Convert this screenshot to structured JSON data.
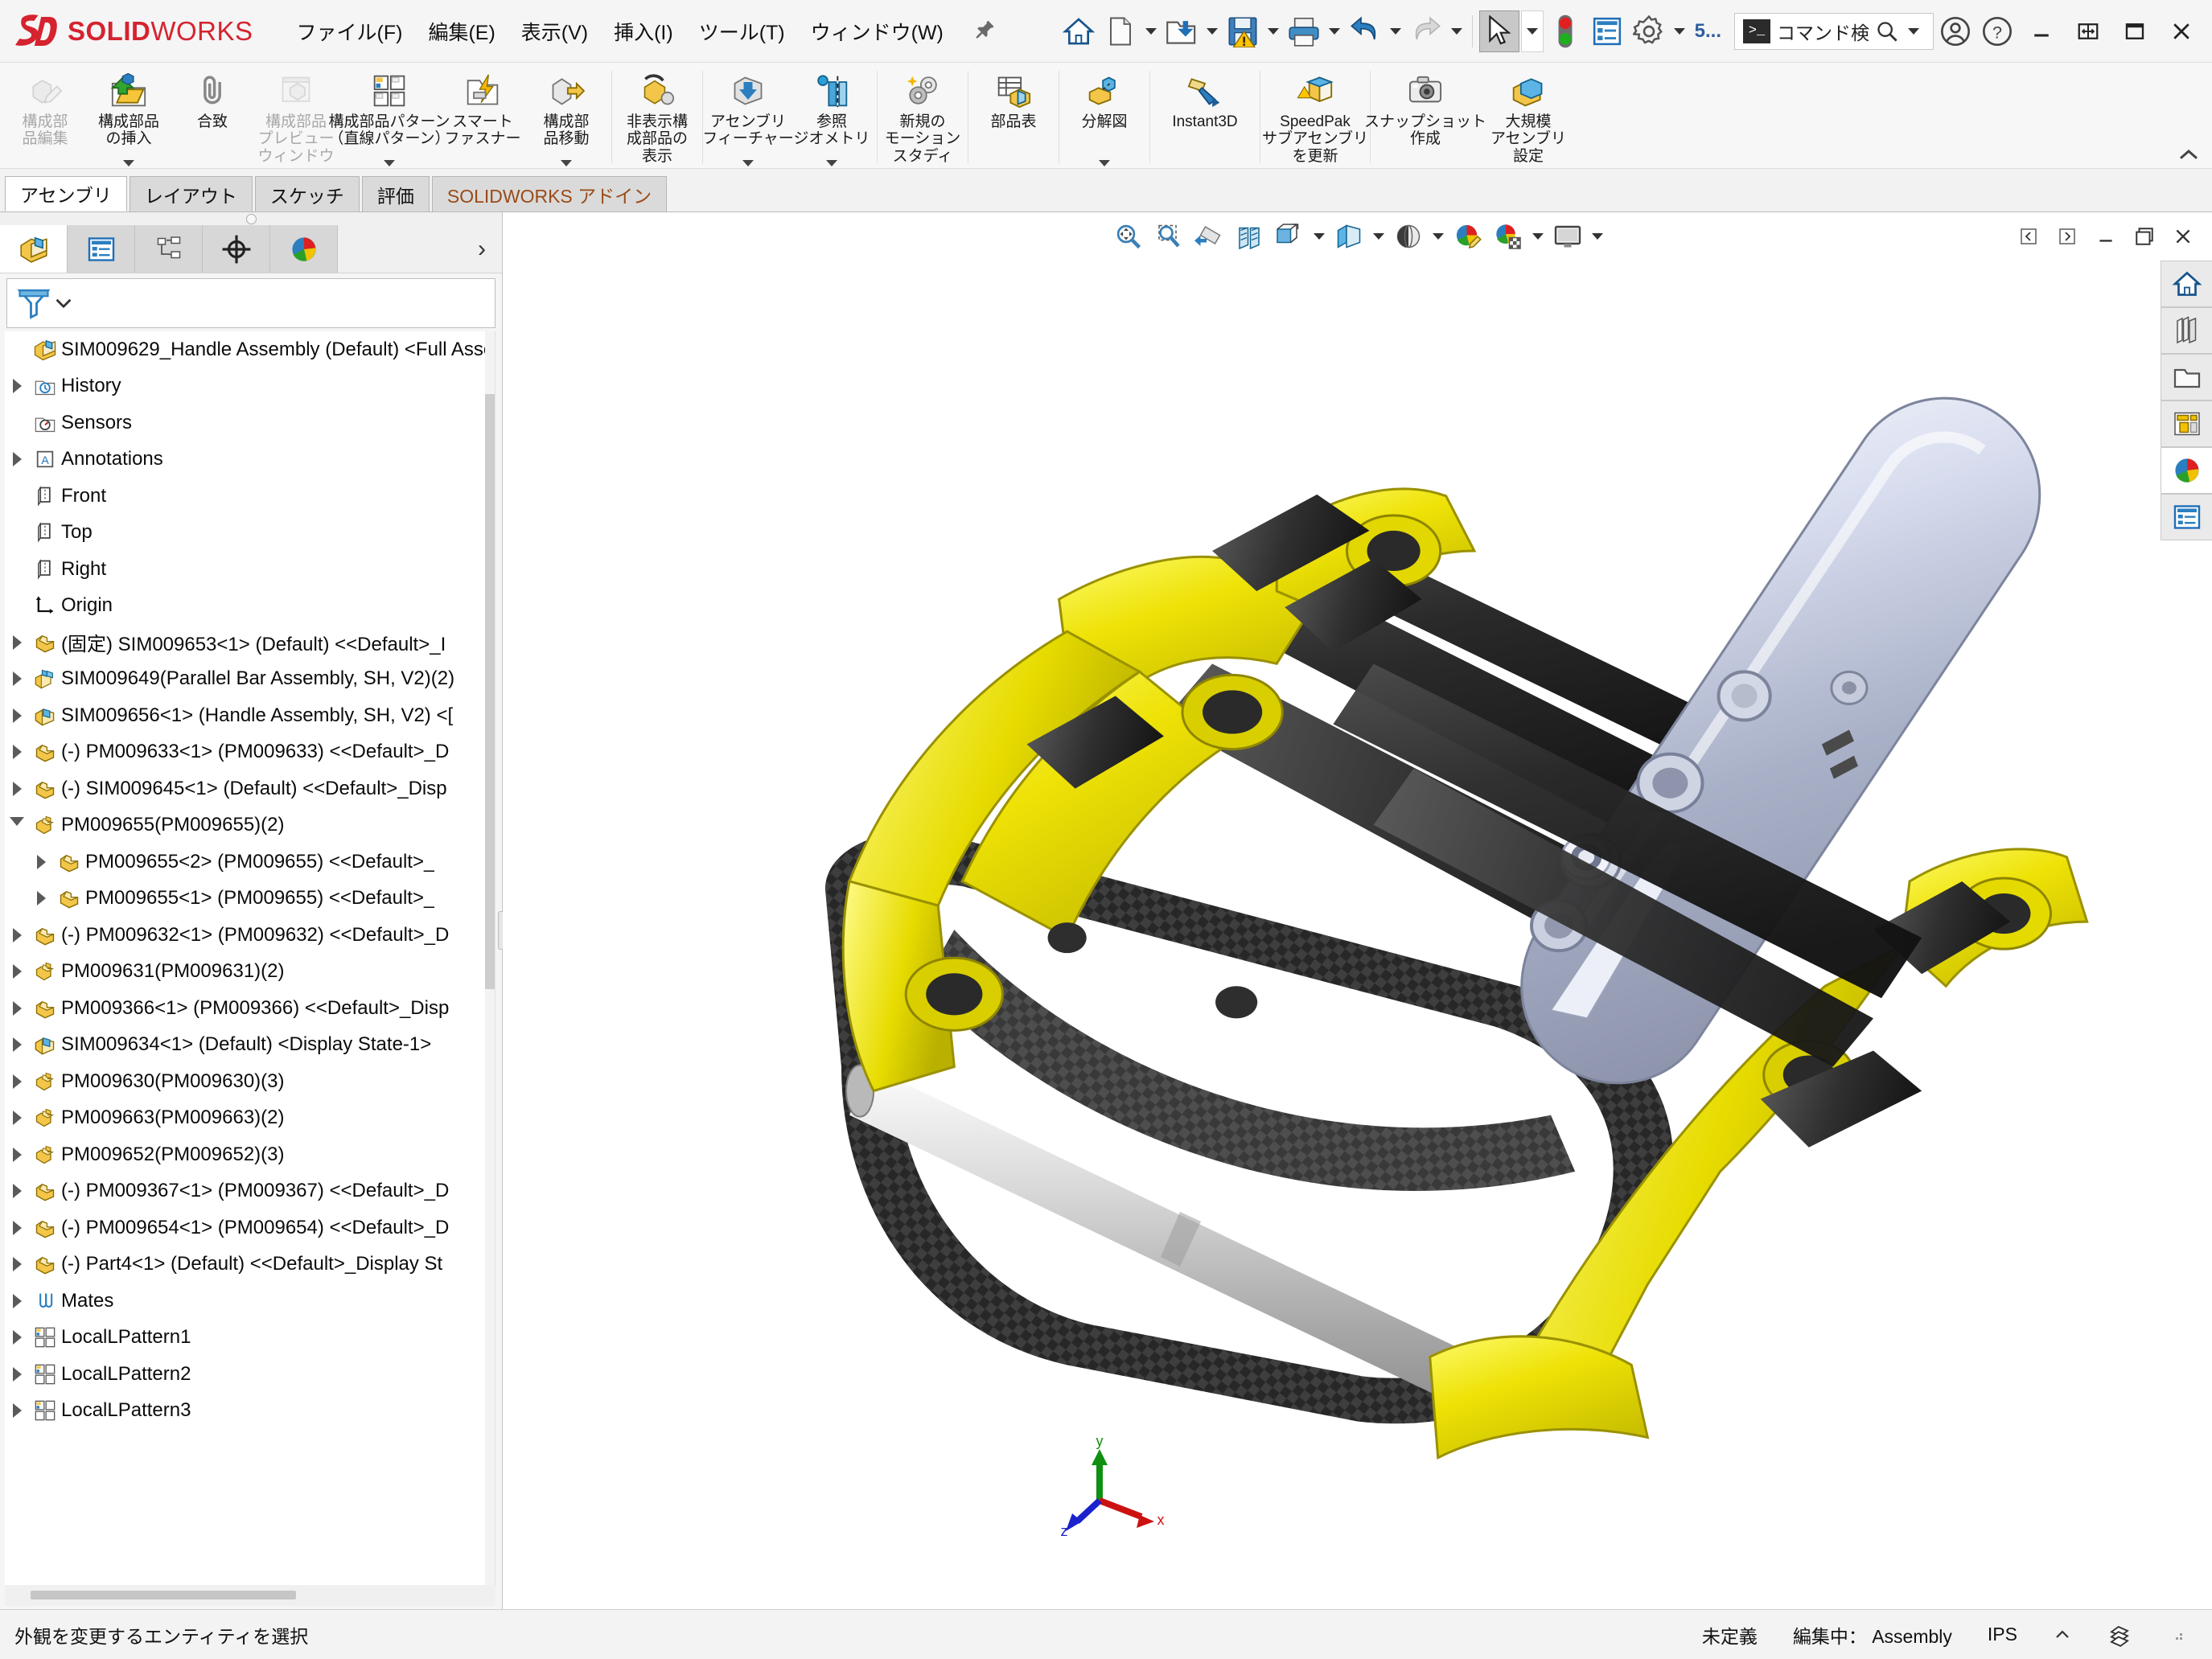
{
  "app": {
    "brand_bold": "SOLID",
    "brand_light": "WORKS",
    "logo": "3DS"
  },
  "menu": {
    "items": [
      {
        "label": "ファイル(F)",
        "name": "menu-file"
      },
      {
        "label": "編集(E)",
        "name": "menu-edit"
      },
      {
        "label": "表示(V)",
        "name": "menu-view"
      },
      {
        "label": "挿入(I)",
        "name": "menu-insert"
      },
      {
        "label": "ツール(T)",
        "name": "menu-tools"
      },
      {
        "label": "ウィンドウ(W)",
        "name": "menu-window"
      }
    ],
    "pin": "pin-icon"
  },
  "quickaccess": {
    "items": [
      {
        "name": "home-icon",
        "caret": false
      },
      {
        "name": "new-document-icon",
        "caret": true
      },
      {
        "name": "open-document-icon",
        "caret": true
      },
      {
        "name": "save-warning-icon",
        "caret": true
      },
      {
        "name": "print-icon",
        "caret": true
      },
      {
        "name": "undo-icon",
        "caret": true
      },
      {
        "name": "redo-icon",
        "caret": true
      },
      {
        "name": "select-cursor-icon",
        "caret": true
      },
      {
        "name": "rebuild-traffic-light-icon",
        "caret": false
      },
      {
        "name": "display-list-icon",
        "caret": false
      },
      {
        "name": "options-gear-icon",
        "caret": true
      }
    ],
    "sw_label": "5...",
    "search": {
      "placeholder": "コマンド検",
      "value": "コマンド検",
      "cmd_icon": "command-prompt-icon",
      "magnifier": "search-icon",
      "caret": "chevron-down-icon"
    },
    "account_icon": "user-account-icon",
    "help_icon": "help-question-icon"
  },
  "windowcontrols": {
    "minimize": "minimize-icon",
    "restore_panes": "split-panes-icon",
    "maximize": "maximize-icon",
    "close": "close-icon"
  },
  "ribbon": {
    "buttons": [
      {
        "label": "構成部\n品編集",
        "name": "edit-component",
        "icon": "edit-component-icon",
        "disabled": true,
        "caret": false
      },
      {
        "label": "構成部品\nの挿入",
        "name": "insert-components",
        "icon": "insert-components-icon",
        "disabled": false,
        "caret": true
      },
      {
        "label": "合致",
        "name": "mate",
        "icon": "mate-paperclip-icon",
        "disabled": false,
        "caret": false
      },
      {
        "label": "構成部品\nプレビュー\nウィンドウ",
        "name": "component-preview-window",
        "icon": "component-preview-icon",
        "disabled": true,
        "caret": false
      },
      {
        "label": "構成部品パターン\n（直線パターン）",
        "name": "linear-component-pattern",
        "icon": "linear-pattern-icon",
        "disabled": false,
        "caret": true
      },
      {
        "label": "スマート\nファスナー",
        "name": "smart-fasteners",
        "icon": "smart-fastener-icon",
        "disabled": false,
        "caret": false
      },
      {
        "label": "構成部\n品移動",
        "name": "move-component",
        "icon": "move-component-icon",
        "disabled": false,
        "caret": true
      },
      {
        "label": "非表示構\n成部品の\n表示",
        "name": "show-hidden-components",
        "icon": "show-hidden-icon",
        "disabled": false,
        "caret": false
      },
      {
        "label": "アセンブリ\nフィーチャー",
        "name": "assembly-features",
        "icon": "assembly-features-icon",
        "disabled": false,
        "caret": true
      },
      {
        "label": "参照\nジオメトリ",
        "name": "reference-geometry",
        "icon": "reference-geometry-icon",
        "disabled": false,
        "caret": true
      },
      {
        "label": "新規の\nモーション\nスタディ",
        "name": "new-motion-study",
        "icon": "motion-study-icon",
        "disabled": false,
        "caret": false
      },
      {
        "label": "部品表",
        "name": "bill-of-materials",
        "icon": "bom-icon",
        "disabled": false,
        "caret": false
      },
      {
        "label": "分解図",
        "name": "exploded-view",
        "icon": "exploded-view-icon",
        "disabled": false,
        "caret": true
      },
      {
        "label": "Instant3D",
        "name": "instant3d",
        "icon": "instant3d-icon",
        "disabled": false,
        "caret": false
      },
      {
        "label": "SpeedPak\nサブアセンブリ\nを更新",
        "name": "update-speedpak-subassembly",
        "icon": "speedpak-icon",
        "disabled": false,
        "caret": false
      },
      {
        "label": "スナップショット\n作成",
        "name": "take-snapshot",
        "icon": "camera-icon",
        "disabled": false,
        "caret": false
      },
      {
        "label": "大規模\nアセンブリ\n設定",
        "name": "large-assembly-settings",
        "icon": "large-assembly-icon",
        "disabled": false,
        "caret": false
      }
    ],
    "collapse_icon": "chevron-up-icon"
  },
  "tabs": [
    {
      "label": "アセンブリ",
      "name": "tab-assembly",
      "active": true
    },
    {
      "label": "レイアウト",
      "name": "tab-layout",
      "active": false
    },
    {
      "label": "スケッチ",
      "name": "tab-sketch",
      "active": false
    },
    {
      "label": "評価",
      "name": "tab-evaluate",
      "active": false
    },
    {
      "label": "SOLIDWORKS アドイン",
      "name": "tab-solidworks-addins",
      "active": false
    }
  ],
  "panel": {
    "tabs": [
      {
        "name": "feature-manager-tab",
        "icon": "feature-tree-icon",
        "active": true
      },
      {
        "name": "property-manager-tab",
        "icon": "property-manager-icon",
        "active": false
      },
      {
        "name": "configuration-manager-tab",
        "icon": "configuration-manager-icon",
        "active": false
      },
      {
        "name": "dimxpert-manager-tab",
        "icon": "dimxpert-icon",
        "active": false
      },
      {
        "name": "display-manager-tab",
        "icon": "display-manager-icon",
        "active": false
      }
    ],
    "more_icon": "chevron-right-icon",
    "filter": {
      "icon": "filter-funnel-icon",
      "caret": "chevron-down-icon",
      "placeholder": "",
      "value": ""
    }
  },
  "tree": {
    "root": {
      "label": "SIM009629_Handle Assembly (Default) <Full Asse",
      "icon": "assembly-icon"
    },
    "items": [
      {
        "label": "History",
        "icon": "history-icon",
        "indent": 1,
        "arrow": "closed"
      },
      {
        "label": "Sensors",
        "icon": "sensors-icon",
        "indent": 1,
        "arrow": "none"
      },
      {
        "label": "Annotations",
        "icon": "annotations-icon",
        "indent": 1,
        "arrow": "closed"
      },
      {
        "label": "Front",
        "icon": "plane-icon",
        "indent": 1,
        "arrow": "none"
      },
      {
        "label": "Top",
        "icon": "plane-icon",
        "indent": 1,
        "arrow": "none"
      },
      {
        "label": "Right",
        "icon": "plane-icon",
        "indent": 1,
        "arrow": "none"
      },
      {
        "label": "Origin",
        "icon": "origin-icon",
        "indent": 1,
        "arrow": "none"
      },
      {
        "label": "(固定) SIM009653<1> (Default) <<Default>_I",
        "icon": "part-icon",
        "indent": 1,
        "arrow": "closed"
      },
      {
        "label": "SIM009649(Parallel Bar Assembly, SH, V2)(2)",
        "icon": "subassembly-pattern-icon",
        "indent": 1,
        "arrow": "closed"
      },
      {
        "label": "SIM009656<1> (Handle Assembly, SH, V2) <[",
        "icon": "subassembly-icon",
        "indent": 1,
        "arrow": "closed"
      },
      {
        "label": "(-) PM009633<1> (PM009633) <<Default>_D",
        "icon": "part-icon",
        "indent": 1,
        "arrow": "closed"
      },
      {
        "label": "(-) SIM009645<1> (Default) <<Default>_Disp",
        "icon": "part-icon",
        "indent": 1,
        "arrow": "closed"
      },
      {
        "label": "PM009655(PM009655)(2)",
        "icon": "component-pattern-icon",
        "indent": 1,
        "arrow": "open"
      },
      {
        "label": "PM009655<2> (PM009655) <<Default>_",
        "icon": "part-icon",
        "indent": 2,
        "arrow": "closed"
      },
      {
        "label": "PM009655<1> (PM009655) <<Default>_",
        "icon": "part-icon",
        "indent": 2,
        "arrow": "closed"
      },
      {
        "label": "(-) PM009632<1> (PM009632) <<Default>_D",
        "icon": "part-icon",
        "indent": 1,
        "arrow": "closed"
      },
      {
        "label": "PM009631(PM009631)(2)",
        "icon": "component-pattern-icon",
        "indent": 1,
        "arrow": "closed"
      },
      {
        "label": "PM009366<1> (PM009366) <<Default>_Disp",
        "icon": "part-icon",
        "indent": 1,
        "arrow": "closed"
      },
      {
        "label": "SIM009634<1> (Default) <Display State-1>",
        "icon": "subassembly-icon",
        "indent": 1,
        "arrow": "closed"
      },
      {
        "label": "PM009630(PM009630)(3)",
        "icon": "component-pattern-icon",
        "indent": 1,
        "arrow": "closed"
      },
      {
        "label": "PM009663(PM009663)(2)",
        "icon": "component-pattern-icon",
        "indent": 1,
        "arrow": "closed"
      },
      {
        "label": "PM009652(PM009652)(3)",
        "icon": "component-pattern-icon",
        "indent": 1,
        "arrow": "closed"
      },
      {
        "label": "(-) PM009367<1> (PM009367) <<Default>_D",
        "icon": "part-icon",
        "indent": 1,
        "arrow": "closed"
      },
      {
        "label": "(-) PM009654<1> (PM009654) <<Default>_D",
        "icon": "part-icon",
        "indent": 1,
        "arrow": "closed"
      },
      {
        "label": "(-) Part4<1> (Default) <<Default>_Display St",
        "icon": "part-icon",
        "indent": 1,
        "arrow": "closed"
      },
      {
        "label": "Mates",
        "icon": "mates-icon",
        "indent": 1,
        "arrow": "closed"
      },
      {
        "label": "LocalLPattern1",
        "icon": "linear-pattern-icon",
        "indent": 1,
        "arrow": "closed"
      },
      {
        "label": "LocalLPattern2",
        "icon": "linear-pattern-icon",
        "indent": 1,
        "arrow": "closed"
      },
      {
        "label": "LocalLPattern3",
        "icon": "linear-pattern-icon",
        "indent": 1,
        "arrow": "closed"
      }
    ]
  },
  "viewtoolbar": {
    "buttons": [
      {
        "name": "zoom-to-fit-icon",
        "caret": false
      },
      {
        "name": "zoom-to-area-icon",
        "caret": false
      },
      {
        "name": "previous-view-icon",
        "caret": false
      },
      {
        "name": "section-view-icon",
        "caret": false
      },
      {
        "name": "view-orientation-icon",
        "caret": true
      },
      {
        "name": "display-style-icon",
        "caret": true
      },
      {
        "name": "hide-show-items-icon",
        "caret": true
      },
      {
        "name": "edit-appearance-icon",
        "caret": false
      },
      {
        "name": "apply-scene-icon",
        "caret": true
      },
      {
        "name": "view-settings-icon",
        "caret": true
      }
    ]
  },
  "viewportwindow": {
    "buttons": [
      {
        "name": "previous-document-icon",
        "label": "◁"
      },
      {
        "name": "next-document-icon",
        "label": "▷"
      },
      {
        "name": "minimize-window-icon",
        "label": "–"
      },
      {
        "name": "restore-window-icon",
        "label": "❐"
      },
      {
        "name": "close-window-icon",
        "label": "✕"
      }
    ]
  },
  "triad": {
    "x": "x",
    "y": "y",
    "z": "z"
  },
  "taskpane": {
    "items": [
      {
        "name": "task-pane-resources-icon",
        "active": false
      },
      {
        "name": "task-pane-design-library-icon",
        "active": false
      },
      {
        "name": "task-pane-file-explorer-icon",
        "active": false
      },
      {
        "name": "task-pane-view-palette-icon",
        "active": false
      },
      {
        "name": "task-pane-appearances-scenes-icon",
        "active": true
      },
      {
        "name": "task-pane-custom-properties-icon",
        "active": false
      }
    ]
  },
  "statusbar": {
    "message": "外観を変更するエンティティを選択",
    "state": "未定義",
    "editing": "編集中： Assembly",
    "units": "IPS",
    "units_caret": "chevron-up-icon",
    "overlay_icon": "overlay-icon"
  },
  "colors": {
    "brand_red": "#d5232f",
    "accent_blue": "#2f5e9e",
    "part_yellow": "#f2e500",
    "carbon_black": "#2b2b2b",
    "steel_gray": "#c8ccd8"
  }
}
